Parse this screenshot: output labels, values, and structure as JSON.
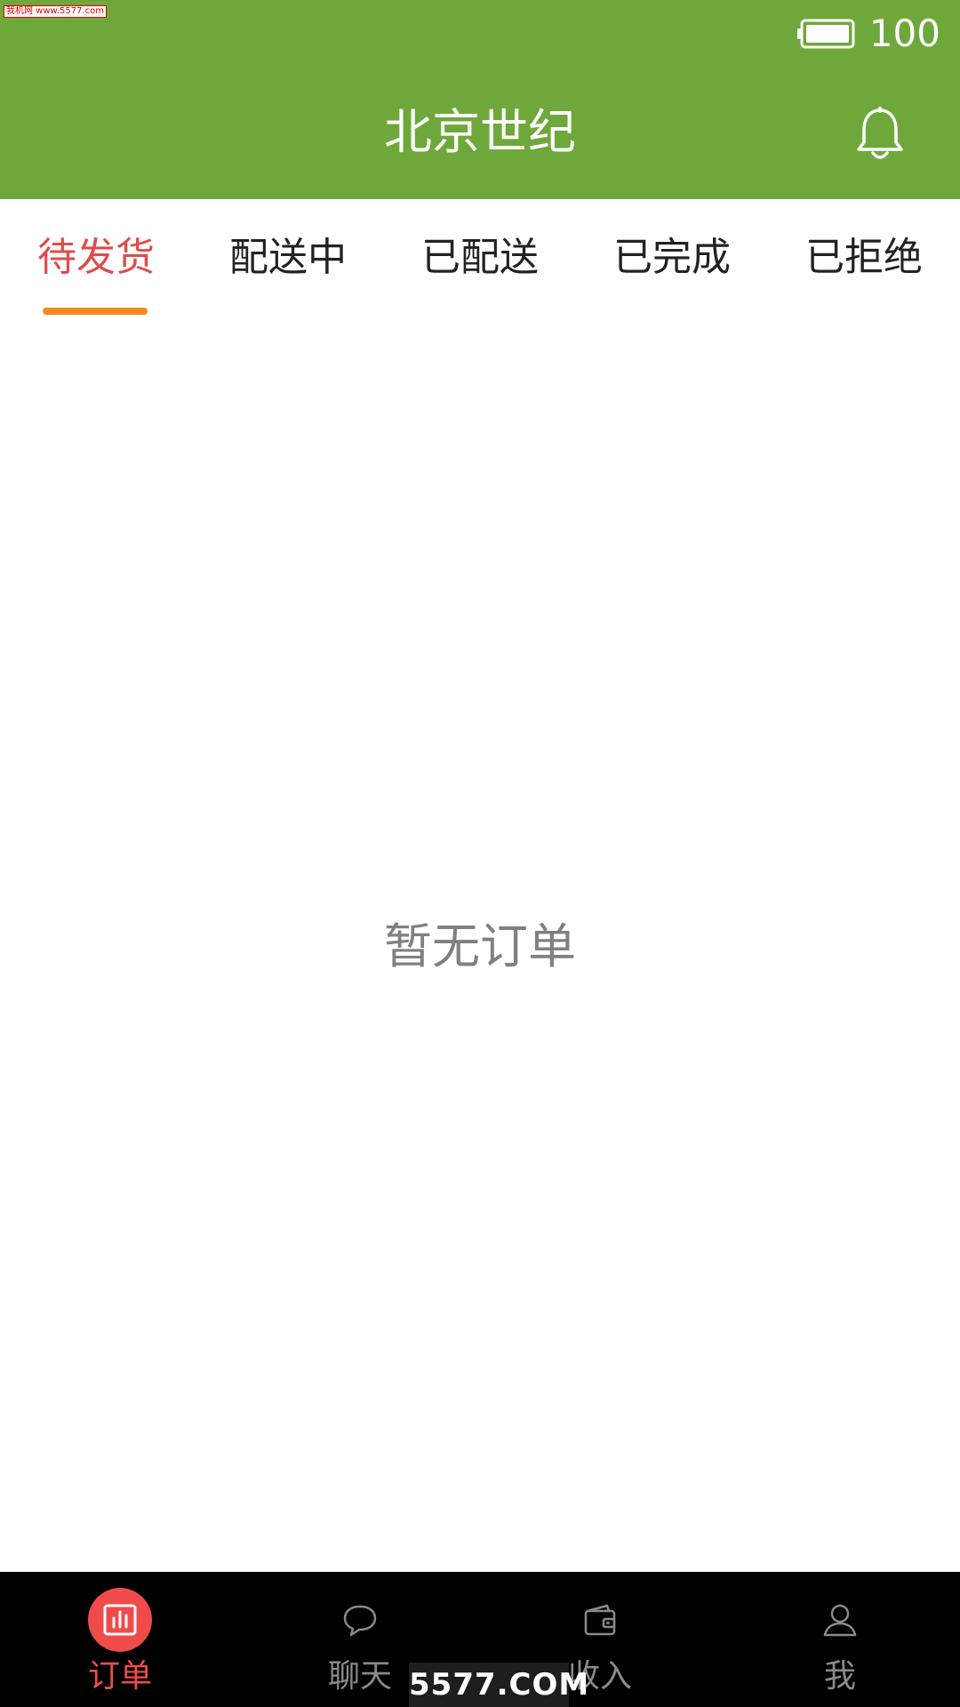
{
  "status_bar": {
    "battery_level": "100"
  },
  "watermark": {
    "top": "我机网 www.5577.com",
    "bottom": "5577.COM"
  },
  "header": {
    "title": "北京世纪",
    "icon": "bell-icon"
  },
  "tabs": [
    {
      "label": "待发货",
      "active": true
    },
    {
      "label": "配送中",
      "active": false
    },
    {
      "label": "已配送",
      "active": false
    },
    {
      "label": "已完成",
      "active": false
    },
    {
      "label": "已拒绝",
      "active": false
    }
  ],
  "empty_state": {
    "text": "暂无订单"
  },
  "bottom_nav": [
    {
      "label": "订单",
      "icon": "bar-chart-icon",
      "active": true
    },
    {
      "label": "聊天",
      "icon": "chat-bubble-icon",
      "active": false
    },
    {
      "label": "收入",
      "icon": "wallet-icon",
      "active": false
    },
    {
      "label": "我",
      "icon": "user-icon",
      "active": false
    }
  ],
  "colors": {
    "header_bg": "#6fa83a",
    "active_tab": "#e04b4b",
    "tab_indicator": "#f5891f",
    "nav_active": "#f04b4b",
    "nav_inactive": "#8a8a8a",
    "nav_bg": "#000000"
  }
}
